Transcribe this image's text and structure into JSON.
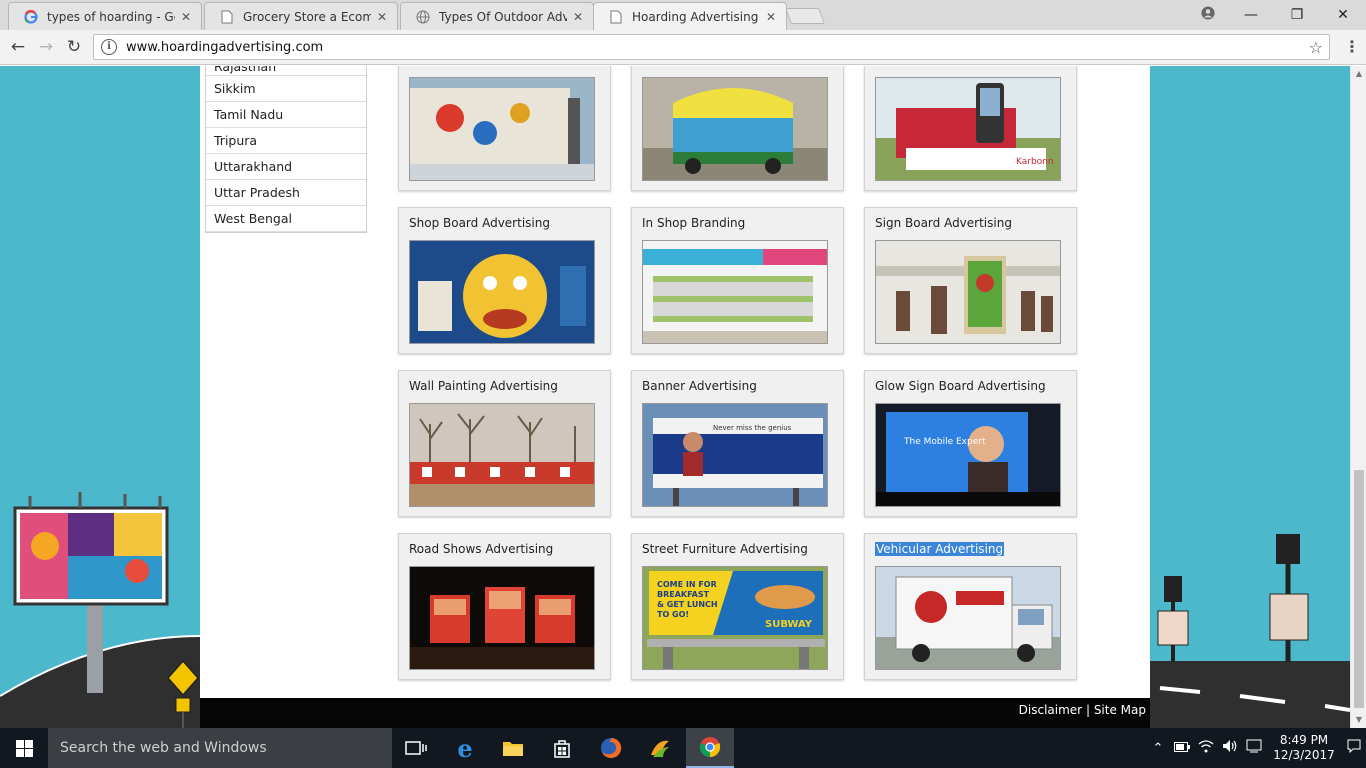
{
  "browser": {
    "tabs": [
      {
        "title": "types of hoarding - Goog",
        "favicon": "google-g-icon",
        "active": false
      },
      {
        "title": "Grocery Store a Ecommer",
        "favicon": "page-icon",
        "active": false
      },
      {
        "title": "Types Of Outdoor Advert",
        "favicon": "globe-icon",
        "active": false
      },
      {
        "title": "Hoarding Advertising In",
        "favicon": "page-icon",
        "active": true
      }
    ],
    "url": "www.hoardingadvertising.com"
  },
  "sidebar": {
    "states": [
      "Rajasthan",
      "Sikkim",
      "Tamil Nadu",
      "Tripura",
      "Uttarakhand",
      "Uttar Pradesh",
      "West Bengal"
    ]
  },
  "gallery": {
    "items": [
      {
        "caption": "",
        "image": "metro-station-wall-ad"
      },
      {
        "caption": "",
        "image": "auto-rickshaw-ad"
      },
      {
        "caption": "",
        "image": "mobile-van-ad"
      },
      {
        "caption": "Shop Board Advertising",
        "image": "shop-board-photo"
      },
      {
        "caption": "In Shop Branding",
        "image": "store-shelves-photo"
      },
      {
        "caption": "Sign Board Advertising",
        "image": "mall-sign-board-photo"
      },
      {
        "caption": "Wall Painting Advertising",
        "image": "painted-wall-photo"
      },
      {
        "caption": "Banner Advertising",
        "image": "billboard-banner-photo"
      },
      {
        "caption": "Glow Sign Board Advertising",
        "image": "glow-sign-photo"
      },
      {
        "caption": "Road Shows Advertising",
        "image": "road-show-trucks-photo"
      },
      {
        "caption": "Street Furniture Advertising",
        "image": "bench-ad-photo"
      },
      {
        "caption": "Vehicular Advertising",
        "image": "delivery-truck-photo",
        "selected": true
      }
    ],
    "overlay_text": {
      "billboard": "Never miss the genius",
      "glow": "The Mobile Expert",
      "subway": [
        "COME IN FOR",
        "BREAKFAST",
        "& GET LUNCH",
        "TO GO!",
        "SUBWAY"
      ],
      "karbonn": "Karbonn"
    }
  },
  "footer": {
    "disclaimer": "Disclaimer",
    "separator": "|",
    "sitemap": "Site Map"
  },
  "taskbar": {
    "search_placeholder": "Search the web and Windows",
    "time": "8:49 PM",
    "date": "12/3/2017"
  },
  "colors": {
    "page_bg": "#4bb8cb",
    "selection": "#3b86d8",
    "footer_bg": "#050505",
    "taskbar_bg": "#12181f"
  }
}
